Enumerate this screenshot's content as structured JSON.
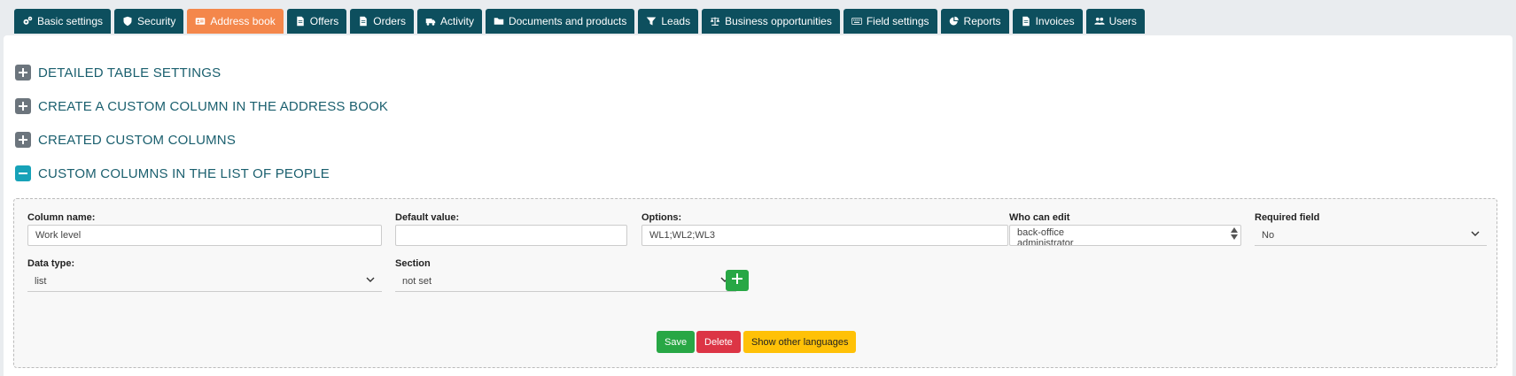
{
  "tabs": [
    {
      "label": "Basic settings",
      "icon": "cogs-icon"
    },
    {
      "label": "Security",
      "icon": "shield-icon"
    },
    {
      "label": "Address book",
      "icon": "address-card-icon",
      "active": true
    },
    {
      "label": "Offers",
      "icon": "file-icon"
    },
    {
      "label": "Orders",
      "icon": "file-icon"
    },
    {
      "label": "Activity",
      "icon": "truck-icon"
    },
    {
      "label": "Documents and products",
      "icon": "folder-icon"
    },
    {
      "label": "Leads",
      "icon": "funnel-icon"
    },
    {
      "label": "Business opportunities",
      "icon": "scale-icon"
    },
    {
      "label": "Field settings",
      "icon": "keyboard-icon"
    },
    {
      "label": "Reports",
      "icon": "pie-chart-icon"
    },
    {
      "label": "Invoices",
      "icon": "file-icon"
    },
    {
      "label": "Users",
      "icon": "users-icon"
    }
  ],
  "sections": [
    {
      "title": "DETAILED TABLE SETTINGS",
      "expanded": false
    },
    {
      "title": "CREATE A CUSTOM COLUMN IN THE ADDRESS BOOK",
      "expanded": false
    },
    {
      "title": "CREATED CUSTOM COLUMNS",
      "expanded": false
    },
    {
      "title": "CUSTOM COLUMNS IN THE LIST OF PEOPLE",
      "expanded": true
    }
  ],
  "form": {
    "column_name": {
      "label": "Column name:",
      "value": "Work level"
    },
    "default_value": {
      "label": "Default value:",
      "value": ""
    },
    "options": {
      "label": "Options:",
      "value": "WL1;WL2;WL3"
    },
    "who_can_edit": {
      "label": "Who can edit",
      "options": [
        "back-office",
        "administrator"
      ]
    },
    "required_field": {
      "label": "Required field",
      "value": "No"
    },
    "data_type": {
      "label": "Data type:",
      "value": "list"
    },
    "section": {
      "label": "Section",
      "value": "not set"
    }
  },
  "buttons": {
    "save": "Save",
    "delete": "Delete",
    "show_languages": "Show other languages"
  },
  "colors": {
    "tab": "#0d4f5e",
    "tab_active": "#f4874b",
    "heading": "#1a5f6e",
    "success": "#28a745",
    "danger": "#dc3545",
    "warning": "#ffc107"
  }
}
